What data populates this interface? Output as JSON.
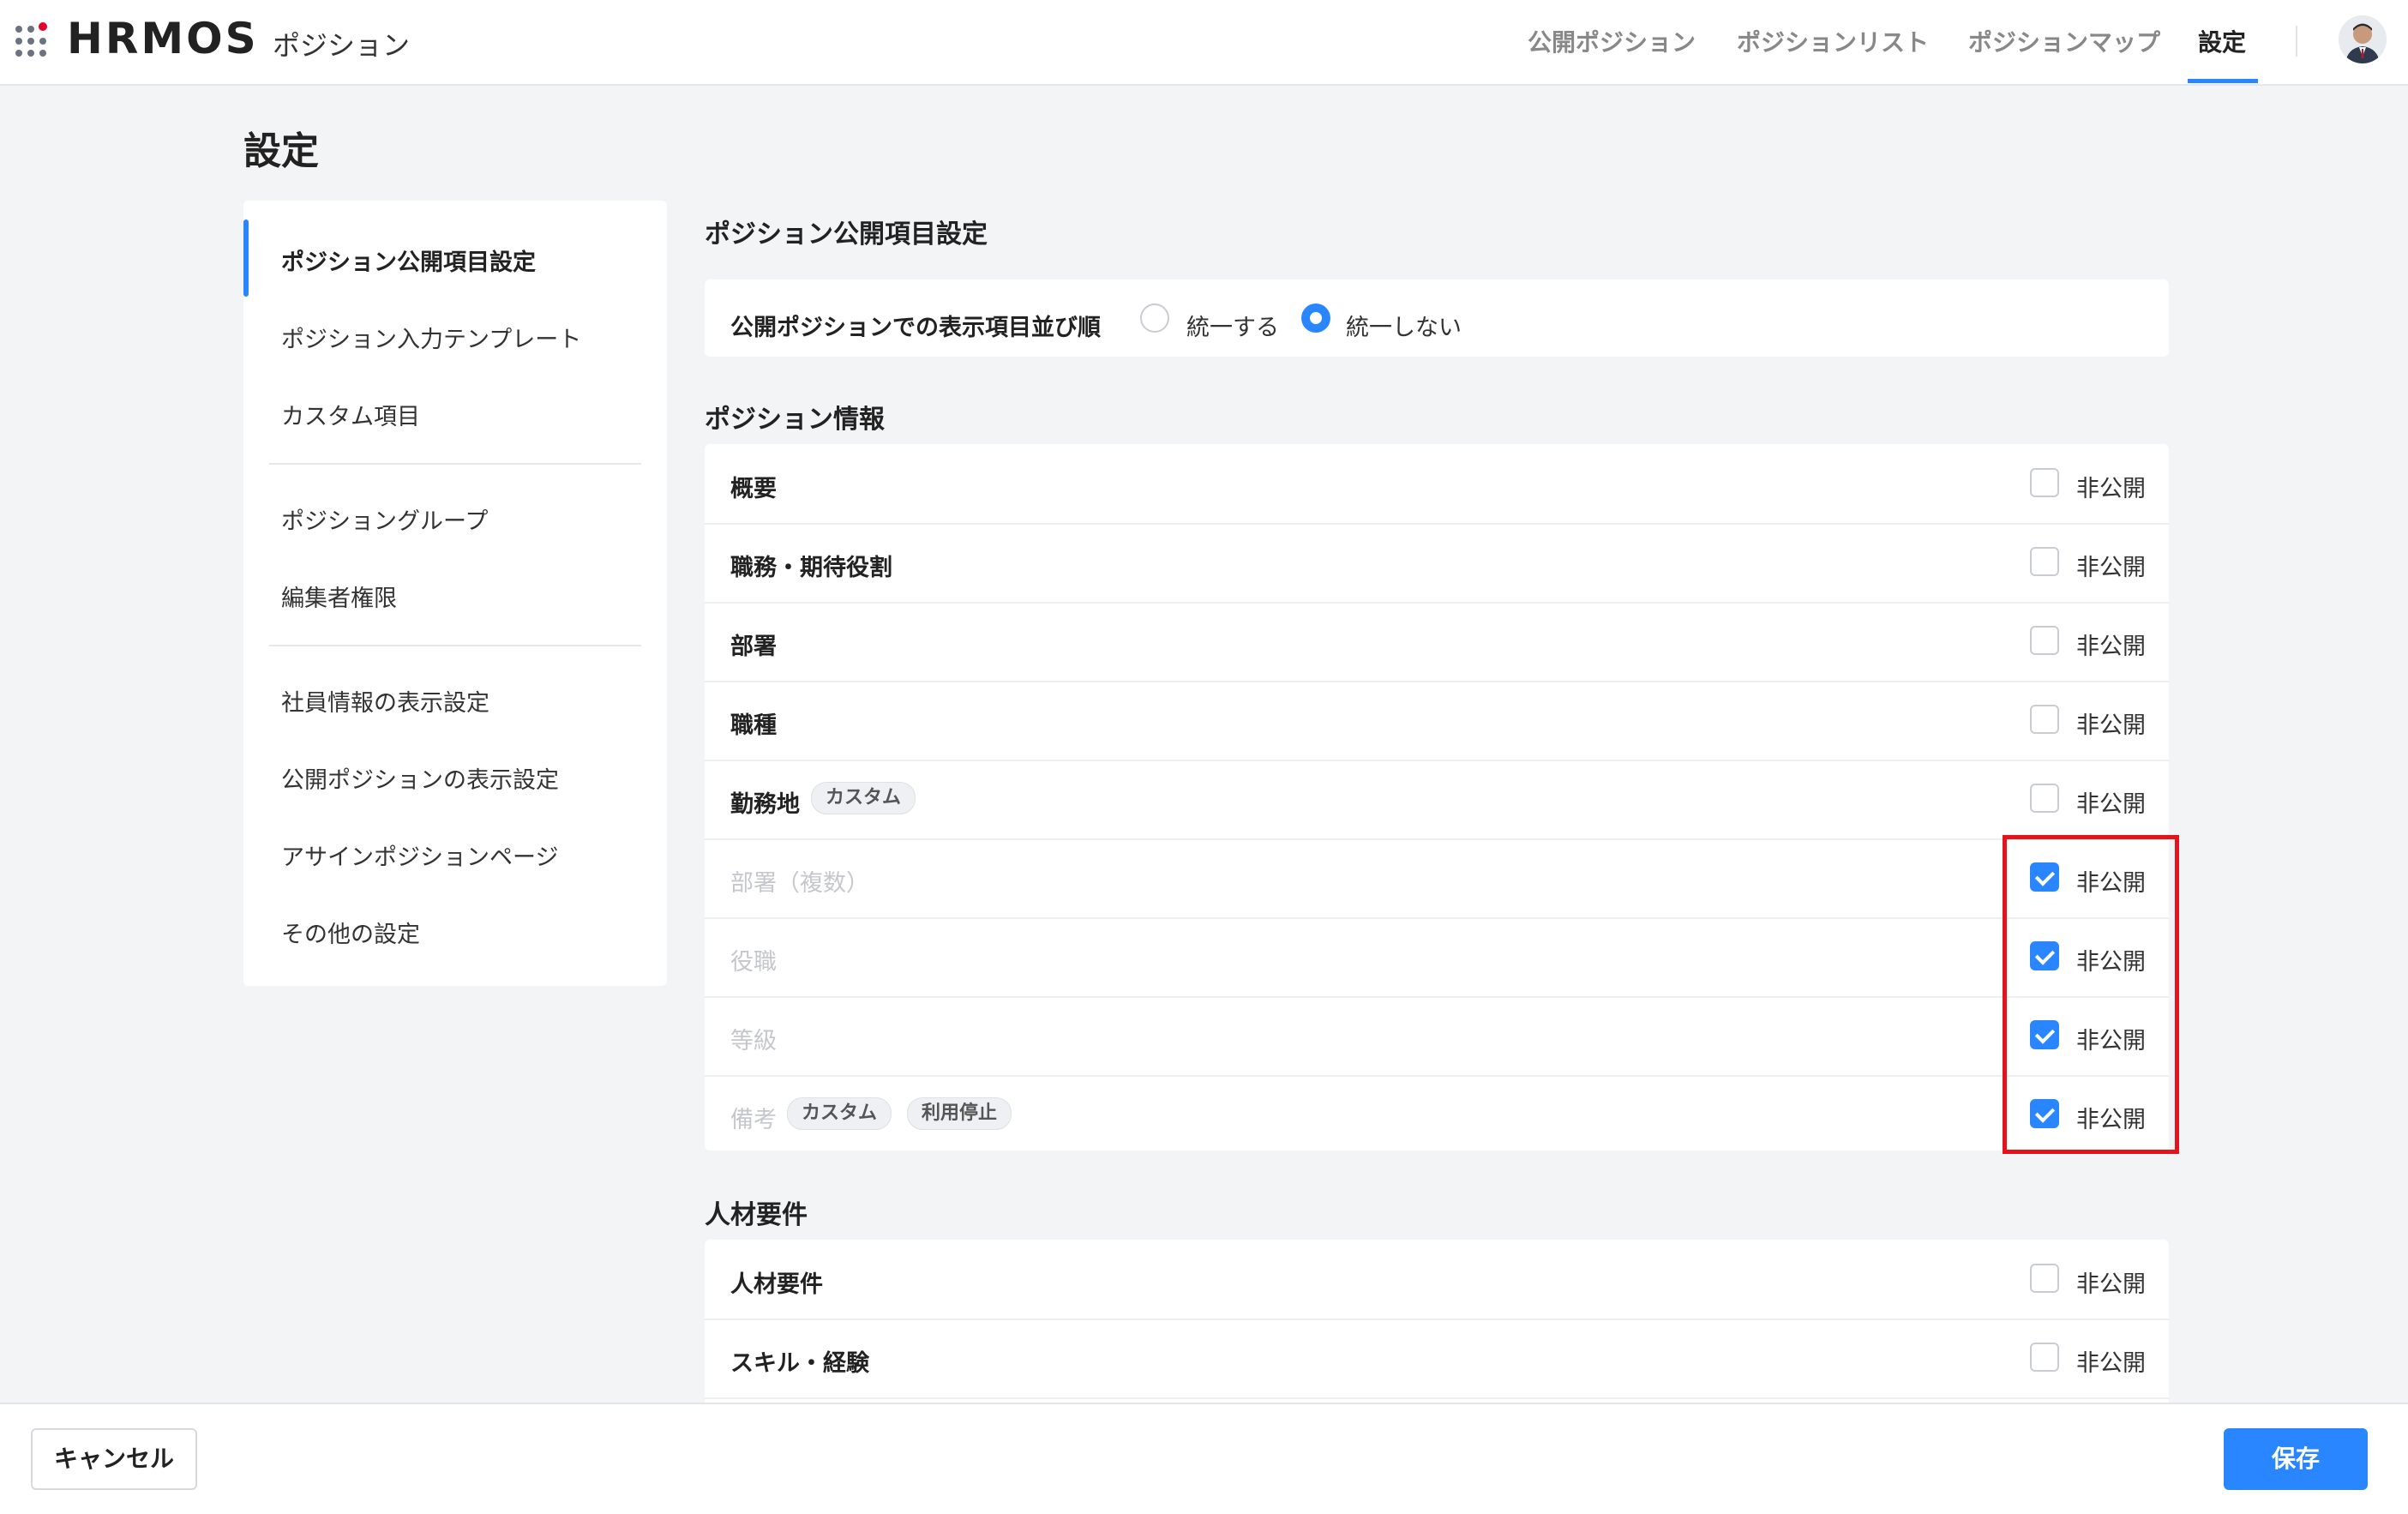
{
  "header": {
    "logo": "HRMOS",
    "app_name": "ポジション",
    "nav": [
      {
        "label": "公開ポジション"
      },
      {
        "label": "ポジションリスト"
      },
      {
        "label": "ポジションマップ"
      },
      {
        "label": "設定",
        "active": true
      }
    ],
    "accent_color": "#2a86ff"
  },
  "page_title": "設定",
  "sidebar": {
    "items": [
      {
        "label": "ポジション公開項目設定",
        "active": true
      },
      {
        "label": "ポジション入力テンプレート"
      },
      {
        "label": "カスタム項目"
      },
      {
        "label": "ポジショングループ"
      },
      {
        "label": "編集者権限"
      },
      {
        "label": "社員情報の表示設定"
      },
      {
        "label": "公開ポジションの表示設定"
      },
      {
        "label": "アサインポジションページ"
      },
      {
        "label": "その他の設定"
      }
    ]
  },
  "main": {
    "section_title": "ポジション公開項目設定",
    "display_order": {
      "label": "公開ポジションでの表示項目並び順",
      "options": [
        {
          "label": "統一する",
          "selected": false
        },
        {
          "label": "統一しない",
          "selected": true
        }
      ]
    },
    "position_info": {
      "title": "ポジション情報",
      "rows": [
        {
          "label": "概要",
          "checkbox_label": "非公開",
          "checked": false
        },
        {
          "label": "職務・期待役割",
          "checkbox_label": "非公開",
          "checked": false
        },
        {
          "label": "部署",
          "checkbox_label": "非公開",
          "checked": false
        },
        {
          "label": "職種",
          "checkbox_label": "非公開",
          "checked": false
        },
        {
          "label": "勤務地",
          "tags": [
            "カスタム"
          ],
          "checkbox_label": "非公開",
          "checked": false
        },
        {
          "label": "部署（複数）",
          "checkbox_label": "非公開",
          "checked": true,
          "disabled": true
        },
        {
          "label": "役職",
          "checkbox_label": "非公開",
          "checked": true,
          "disabled": true
        },
        {
          "label": "等級",
          "checkbox_label": "非公開",
          "checked": true,
          "disabled": true
        },
        {
          "label": "備考",
          "tags": [
            "カスタム",
            "利用停止"
          ],
          "checkbox_label": "非公開",
          "checked": true,
          "disabled": true
        }
      ]
    },
    "requirements": {
      "title": "人材要件",
      "rows": [
        {
          "label": "人材要件",
          "checkbox_label": "非公開",
          "checked": false
        },
        {
          "label": "スキル・経験",
          "checkbox_label": "非公開",
          "checked": false
        }
      ]
    }
  },
  "footer": {
    "cancel_label": "キャンセル",
    "save_label": "保存"
  },
  "annotation_color": "#e5141c"
}
